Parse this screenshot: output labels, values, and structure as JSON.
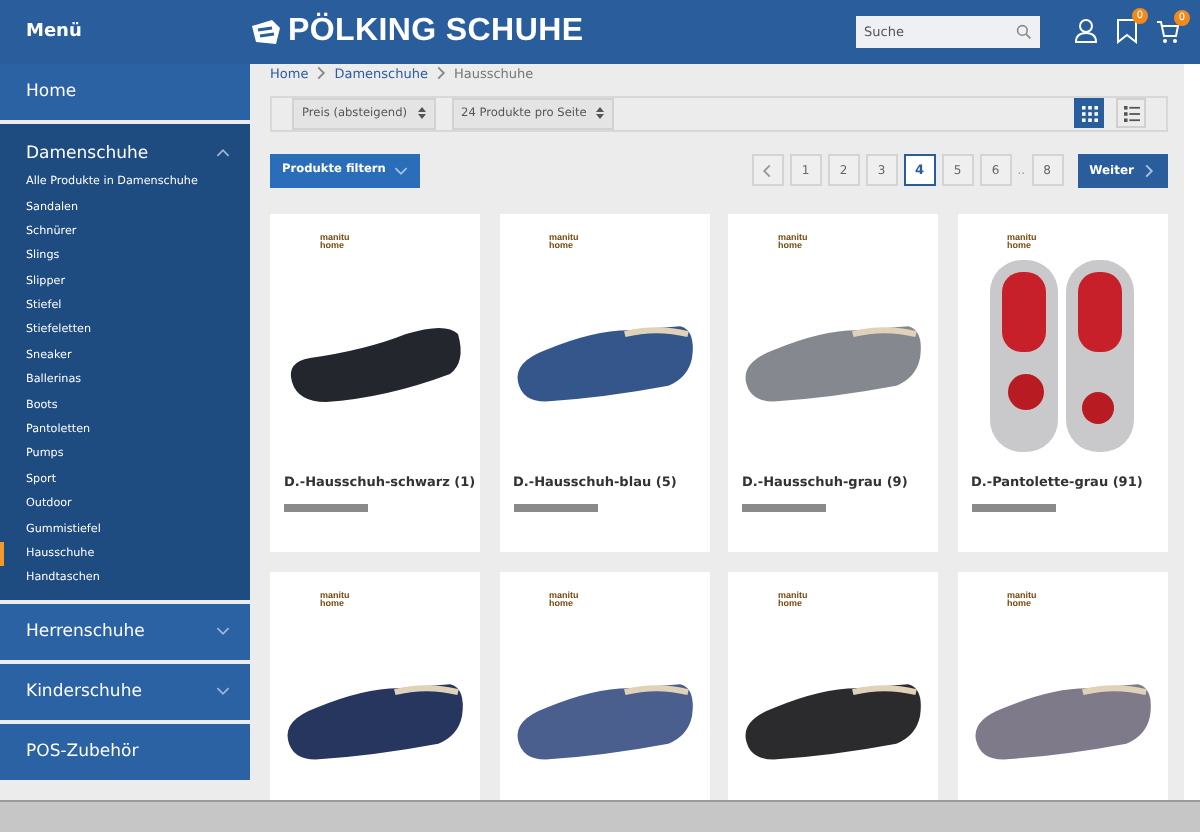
{
  "header": {
    "menu_label": "Menü",
    "logo": "PÖLKING SCHUHE",
    "search": {
      "placeholder": "Suche"
    },
    "wishlist_badge": "0",
    "cart_badge": "0"
  },
  "sidebar": {
    "items": [
      {
        "label": "Home",
        "kind": "link"
      },
      {
        "label": "Damenschuhe",
        "kind": "group",
        "expanded": true,
        "children": [
          {
            "label": "Alle Produkte in Damenschuhe",
            "selected": false
          },
          {
            "label": "Sandalen",
            "selected": false
          },
          {
            "label": "Schnürer",
            "selected": false
          },
          {
            "label": "Slings",
            "selected": false
          },
          {
            "label": "Slipper",
            "selected": false
          },
          {
            "label": "Stiefel",
            "selected": false
          },
          {
            "label": "Stiefeletten",
            "selected": false
          },
          {
            "label": "Sneaker",
            "selected": false
          },
          {
            "label": "Ballerinas",
            "selected": false
          },
          {
            "label": "Boots",
            "selected": false
          },
          {
            "label": "Pantoletten",
            "selected": false
          },
          {
            "label": "Pumps",
            "selected": false
          },
          {
            "label": "Sport",
            "selected": false
          },
          {
            "label": "Outdoor",
            "selected": false
          },
          {
            "label": "Gummistiefel",
            "selected": false
          },
          {
            "label": "Hausschuhe",
            "selected": true
          },
          {
            "label": "Handtaschen",
            "selected": false
          }
        ]
      },
      {
        "label": "Herrenschuhe",
        "kind": "group",
        "expanded": false
      },
      {
        "label": "Kinderschuhe",
        "kind": "group",
        "expanded": false
      },
      {
        "label": "POS-Zubehör",
        "kind": "link"
      }
    ]
  },
  "breadcrumb": [
    "Home",
    "Damenschuhe",
    "Hausschuhe"
  ],
  "toolbar": {
    "sort": "Preis (absteigend)",
    "per_page": "24 Produkte pro Seite",
    "views": [
      {
        "kind": "grid",
        "selected": true
      },
      {
        "kind": "list",
        "selected": false
      }
    ]
  },
  "filter_button": "Produkte filtern",
  "pagination": {
    "pages": [
      {
        "label": "1",
        "kind": "page",
        "selected": false
      },
      {
        "label": "2",
        "kind": "page",
        "selected": false
      },
      {
        "label": "3",
        "kind": "page",
        "selected": false
      },
      {
        "label": "4",
        "kind": "page",
        "selected": true
      },
      {
        "label": "5",
        "kind": "page",
        "selected": false
      },
      {
        "label": "6",
        "kind": "page",
        "selected": false
      },
      {
        "label": "..",
        "kind": "gap"
      },
      {
        "label": "8",
        "kind": "page",
        "selected": false
      }
    ],
    "next": "Weiter"
  },
  "products": [
    {
      "brand": "manitu home",
      "title": "D.-Hausschuh-schwarz (1)",
      "kind": "ballerina",
      "color": "#23262d"
    },
    {
      "brand": "manitu home",
      "title": "D.-Hausschuh-blau (5)",
      "kind": "clog",
      "color": "#34568a"
    },
    {
      "brand": "manitu home",
      "title": "D.-Hausschuh-grau (9)",
      "kind": "clog",
      "color": "#85898f"
    },
    {
      "brand": "manitu home",
      "title": "D.-Pantolette-grau (91)",
      "kind": "pair",
      "color": "#c9c9cc"
    },
    {
      "brand": "manitu home",
      "kind": "clog",
      "color": "#27365f"
    },
    {
      "brand": "manitu home",
      "kind": "clog",
      "color": "#4a5f8e"
    },
    {
      "brand": "manitu home",
      "kind": "clog",
      "color": "#2b2b2e"
    },
    {
      "brand": "manitu home",
      "kind": "clog",
      "color": "#7f7a8a"
    }
  ]
}
